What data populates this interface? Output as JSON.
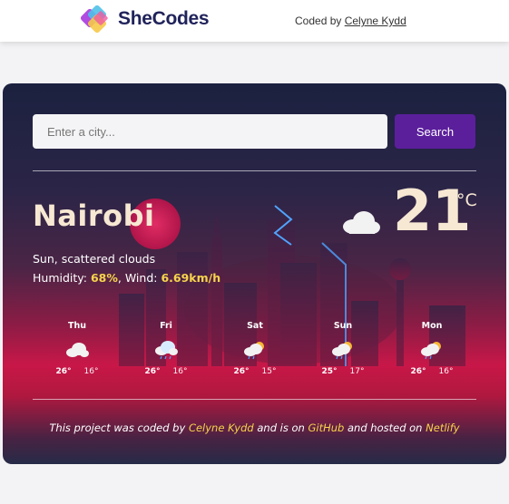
{
  "header": {
    "brand": "SheCodes",
    "coded_by_prefix": "Coded by",
    "author": "Celyne Kydd"
  },
  "search": {
    "placeholder": "Enter a city...",
    "button_label": "Search"
  },
  "current": {
    "city": "Nairobi",
    "description": "Sun, scattered clouds",
    "humidity_label": "Humidity:",
    "humidity_value": "68%",
    "wind_label": "Wind:",
    "wind_value": "6.69km/h",
    "temperature": "21",
    "unit": "°C",
    "icon": "cloud-icon"
  },
  "forecast": [
    {
      "day": "Thu",
      "max": "26°",
      "min": "16°",
      "icon": "cloud-icon"
    },
    {
      "day": "Fri",
      "max": "26°",
      "min": "16°",
      "icon": "cloud-rain-icon"
    },
    {
      "day": "Sat",
      "max": "26°",
      "min": "15°",
      "icon": "sun-cloud-rain-icon"
    },
    {
      "day": "Sun",
      "max": "25°",
      "min": "17°",
      "icon": "sun-cloud-rain-icon"
    },
    {
      "day": "Mon",
      "max": "26°",
      "min": "16°",
      "icon": "sun-cloud-rain-icon"
    }
  ],
  "footer": {
    "text_1": "This project was coded by",
    "author": "Celyne Kydd",
    "text_2": "and is on",
    "github": "GitHub",
    "text_3": "and hosted on",
    "netlify": "Netlify"
  },
  "colors": {
    "accent_yellow": "#f7d44c",
    "search_button": "#5b1f9c",
    "brand_navy": "#20235a"
  }
}
